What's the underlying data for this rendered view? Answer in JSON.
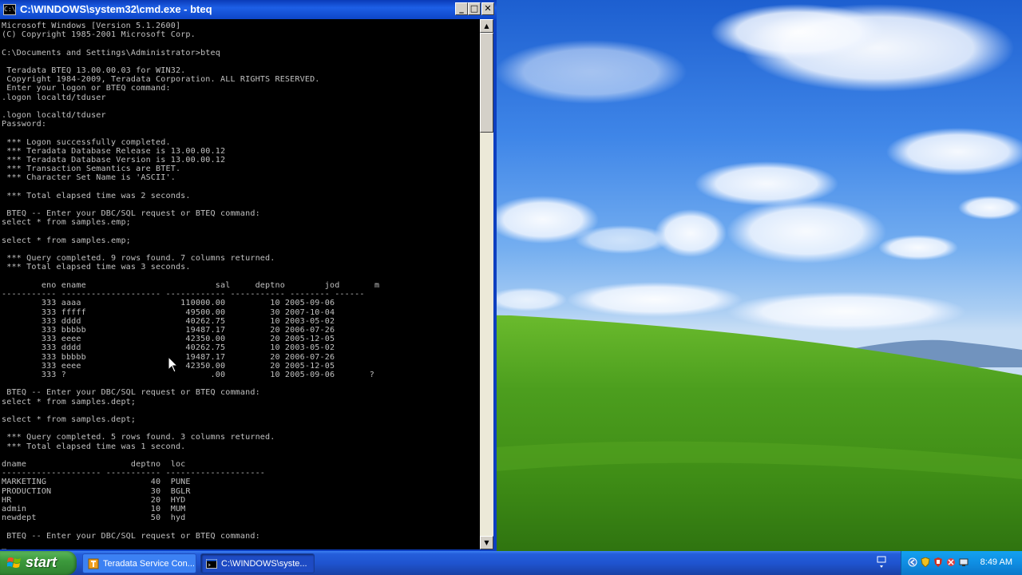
{
  "window": {
    "title": "C:\\WINDOWS\\system32\\cmd.exe - bteq",
    "icon": "cmd-icon",
    "controls": {
      "minimize": "_",
      "maximize": "□",
      "close": "✕"
    }
  },
  "console": {
    "lines": [
      "Microsoft Windows [Version 5.1.2600]",
      "(C) Copyright 1985-2001 Microsoft Corp.",
      "",
      "C:\\Documents and Settings\\Administrator>bteq",
      "",
      " Teradata BTEQ 13.00.00.03 for WIN32.",
      " Copyright 1984-2009, Teradata Corporation. ALL RIGHTS RESERVED.",
      " Enter your logon or BTEQ command:",
      ".logon localtd/tduser",
      "",
      ".logon localtd/tduser",
      "Password:",
      "",
      " *** Logon successfully completed.",
      " *** Teradata Database Release is 13.00.00.12",
      " *** Teradata Database Version is 13.00.00.12",
      " *** Transaction Semantics are BTET.",
      " *** Character Set Name is 'ASCII'.",
      "",
      " *** Total elapsed time was 2 seconds.",
      "",
      " BTEQ -- Enter your DBC/SQL request or BTEQ command:",
      "select * from samples.emp;",
      "",
      "select * from samples.emp;",
      "",
      " *** Query completed. 9 rows found. 7 columns returned.",
      " *** Total elapsed time was 3 seconds.",
      "",
      "        eno ename                          sal     deptno        jod       m",
      "----------- -------------------- ------------ ----------- -------- ------",
      "        333 aaaa                    110000.00         10 2005-09-06",
      "        333 fffff                    49500.00         30 2007-10-04",
      "        333 dddd                     40262.75         10 2003-05-02",
      "        333 bbbbb                    19487.17         20 2006-07-26",
      "        333 eeee                     42350.00         20 2005-12-05",
      "        333 dddd                     40262.75         10 2003-05-02",
      "        333 bbbbb                    19487.17         20 2006-07-26",
      "        333 eeee                     42350.00         20 2005-12-05",
      "        333 ?                             .00         10 2005-09-06       ?",
      "",
      " BTEQ -- Enter your DBC/SQL request or BTEQ command:",
      "select * from samples.dept;",
      "",
      "select * from samples.dept;",
      "",
      " *** Query completed. 5 rows found. 3 columns returned.",
      " *** Total elapsed time was 1 second.",
      "",
      "dname                     deptno  loc",
      "-------------------- ----------- --------------------",
      "MARKETING                     40  PUNE",
      "PRODUCTION                    30  BGLR",
      "HR                            20  HYD",
      "admin                         10  MUM",
      "newdept                       50  hyd",
      "",
      " BTEQ -- Enter your DBC/SQL request or BTEQ command:",
      "_"
    ]
  },
  "scrollbar": {
    "up": "▲",
    "down": "▼"
  },
  "taskbar": {
    "start_label": "start",
    "tasks": [
      {
        "label": "Teradata Service Con...",
        "icon": "teradata-service-icon"
      },
      {
        "label": "C:\\WINDOWS\\syste...",
        "icon": "cmd-icon"
      }
    ],
    "tray": {
      "clock": "8:49 AM",
      "icons": [
        "network-icon",
        "shield-icon",
        "security-icon",
        "antivirus-icon",
        "display-icon"
      ]
    }
  },
  "colors": {
    "titlebar": "#0a3ab8",
    "console_bg": "#000000",
    "console_fg": "#c0c0c0",
    "taskbar": "#245edb",
    "start": "#3c9a3c",
    "tray": "#0f8ee3"
  }
}
